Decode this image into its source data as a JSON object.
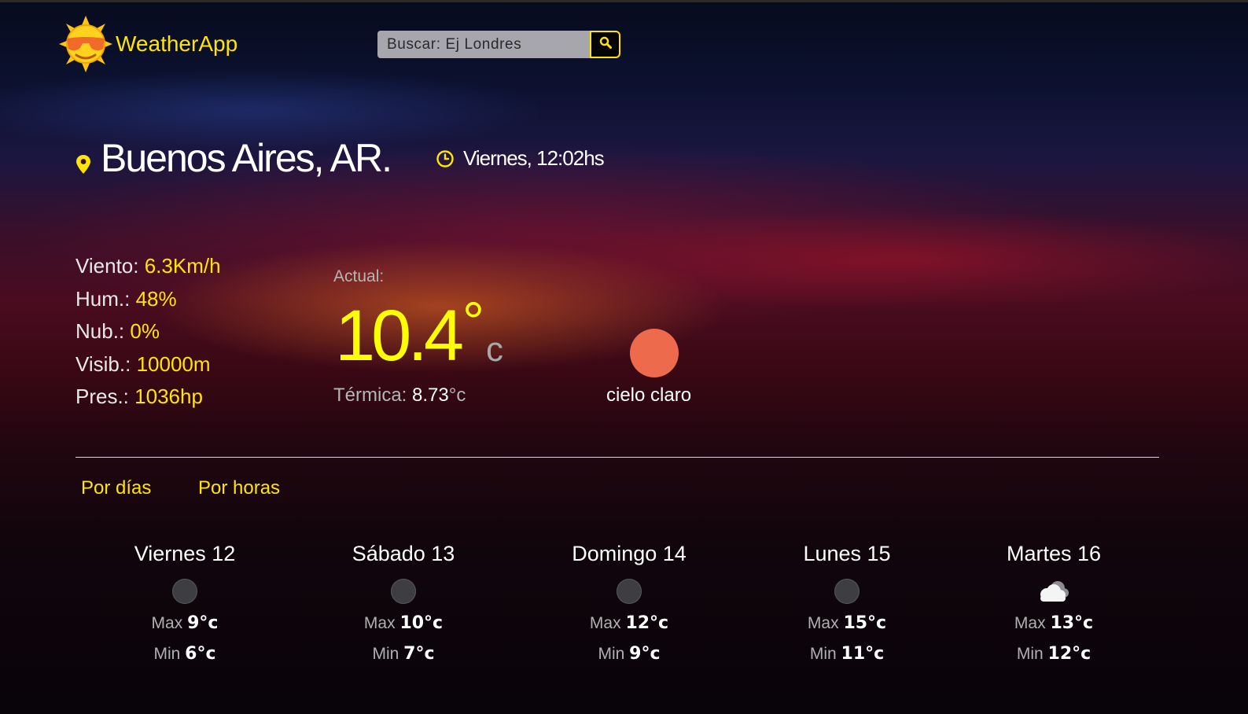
{
  "header": {
    "app_name": "WeatherApp",
    "search_placeholder": "Buscar: Ej Londres"
  },
  "location": {
    "city": "Buenos Aires, AR.",
    "datetime": "Viernes, 12:02hs"
  },
  "details": [
    {
      "label": "Viento:",
      "value": "6.3Km/h"
    },
    {
      "label": "Hum.:",
      "value": "48%"
    },
    {
      "label": "Nub.:",
      "value": "0%"
    },
    {
      "label": "Visib.:",
      "value": "10000m"
    },
    {
      "label": "Pres.:",
      "value": "1036hp"
    }
  ],
  "current": {
    "label": "Actual:",
    "temp": "10.4",
    "deg": "°",
    "unit": "c",
    "feels_label": "Térmica:",
    "feels_value": "8.73",
    "feels_unit": "°c",
    "condition": "cielo claro",
    "condition_icon": "sun-icon",
    "condition_color": "#ee6a4c"
  },
  "tabs": [
    "Por días",
    "Por horas"
  ],
  "forecast": [
    {
      "day": "Viernes 12",
      "icon": "moon-icon",
      "max_label": "Max",
      "max": "9°c",
      "min_label": "Min",
      "min": "6°c"
    },
    {
      "day": "Sábado 13",
      "icon": "moon-icon",
      "max_label": "Max",
      "max": "10°c",
      "min_label": "Min",
      "min": "7°c"
    },
    {
      "day": "Domingo 14",
      "icon": "moon-icon",
      "max_label": "Max",
      "max": "12°c",
      "min_label": "Min",
      "min": "9°c"
    },
    {
      "day": "Lunes 15",
      "icon": "moon-icon",
      "max_label": "Max",
      "max": "15°c",
      "min_label": "Min",
      "min": "11°c"
    },
    {
      "day": "Martes 16",
      "icon": "cloud-icon",
      "max_label": "Max",
      "max": "13°c",
      "min_label": "Min",
      "min": "12°c"
    }
  ],
  "colors": {
    "accent": "#ffe500",
    "temperature": "#ffff00"
  }
}
